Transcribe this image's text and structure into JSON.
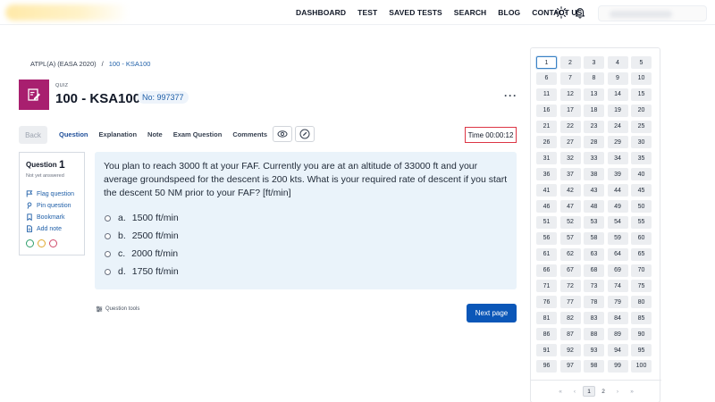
{
  "nav": {
    "items": [
      "DASHBOARD",
      "TEST",
      "SAVED TESTS",
      "SEARCH",
      "BLOG",
      "CONTACT US"
    ]
  },
  "breadcrumb": {
    "root": "ATPL(A) (EASA 2020)",
    "separator": "/",
    "current": "100 - KSA100"
  },
  "quiz": {
    "kicker": "QUIZ",
    "title": "100 - KSA100",
    "number": "No: 997377",
    "accent_color": "#a81f6f"
  },
  "toolbar": {
    "back_label": "Back",
    "tabs": [
      "Question",
      "Explanation",
      "Note",
      "Exam Question",
      "Comments"
    ],
    "active_tab": "Question",
    "timer": "Time 00:00:12"
  },
  "question_info": {
    "label": "Question",
    "number": "1",
    "status": "Not yet answered",
    "actions": [
      {
        "label": "Flag question",
        "icon": "flag-icon"
      },
      {
        "label": "Pin question",
        "icon": "pin-icon"
      },
      {
        "label": "Bookmark",
        "icon": "bookmark-icon"
      },
      {
        "label": "Add note",
        "icon": "note-icon"
      }
    ],
    "color_tags": [
      "#2e9e6b",
      "#e0a82e",
      "#d04a6a"
    ]
  },
  "question": {
    "text": "You plan to reach 3000 ft at your FAF. Currently you are at an altitude of 33000 ft and your average groundspeed for the descent is 200 kts. What is your required rate of descent if you start the descent 50 NM prior to your FAF? [ft/min]",
    "answers": [
      {
        "letter": "a.",
        "text": "1500 ft/min"
      },
      {
        "letter": "b.",
        "text": "2500 ft/min"
      },
      {
        "letter": "c.",
        "text": "2000 ft/min"
      },
      {
        "letter": "d.",
        "text": "1750 ft/min"
      }
    ]
  },
  "footer": {
    "tools_label": "Question tools",
    "next_label": "Next page",
    "primary_color": "#0b57b8"
  },
  "question_nav": {
    "current": 1,
    "count": 100,
    "pager": {
      "first": "«",
      "prev": "‹",
      "pages": [
        "1",
        "2"
      ],
      "active_page": "1",
      "next": "›",
      "last": "»"
    }
  }
}
